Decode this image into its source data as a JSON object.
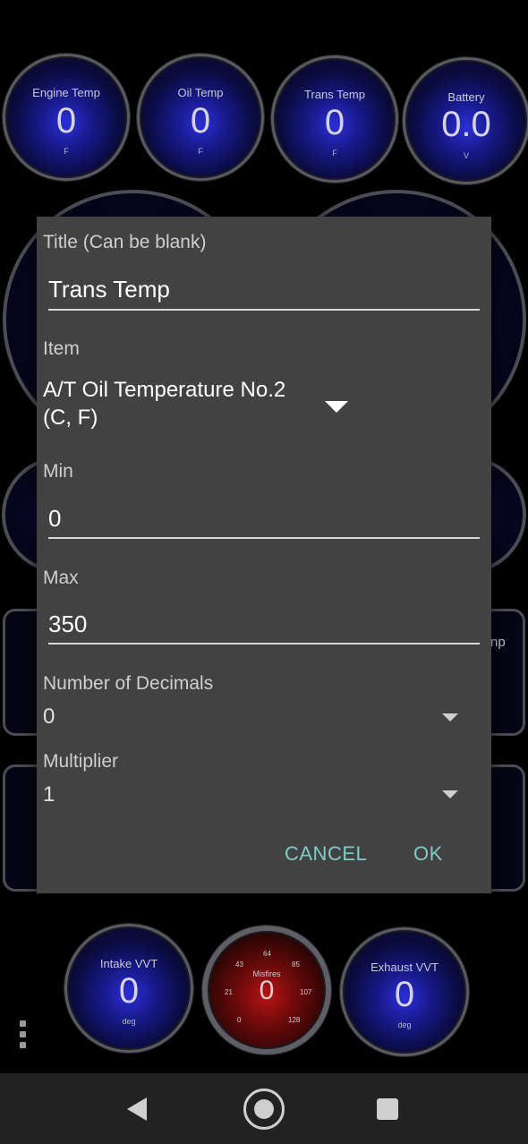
{
  "gauges_top": [
    {
      "title": "Engine Temp",
      "value": "0",
      "unit": "F"
    },
    {
      "title": "Oil Temp",
      "value": "0",
      "unit": "F"
    },
    {
      "title": "Trans Temp",
      "value": "0",
      "unit": "F"
    },
    {
      "title": "Battery",
      "value": "0.0",
      "unit": "V"
    }
  ],
  "background_partial_label": "np",
  "gauges_bottom": [
    {
      "title": "Intake VVT",
      "value": "0",
      "unit": "deg"
    },
    {
      "title": "Misfires",
      "value": "0",
      "ticks": [
        "64",
        "43",
        "85",
        "21",
        "107",
        "0",
        "128"
      ]
    },
    {
      "title": "Exhaust VVT",
      "value": "0",
      "unit": "deg"
    }
  ],
  "dialog": {
    "title_label": "Title (Can be blank)",
    "title_value": "Trans Temp",
    "item_label": "Item",
    "item_value_line1": "A/T Oil Temperature No.2",
    "item_value_line2": "(C, F)",
    "min_label": "Min",
    "min_value": "0",
    "max_label": "Max",
    "max_value": "350",
    "decimals_label": "Number of Decimals",
    "decimals_value": "0",
    "multiplier_label": "Multiplier",
    "multiplier_value": "1",
    "cancel_label": "CANCEL",
    "ok_label": "OK"
  },
  "colors": {
    "accent": "#80cbc4",
    "dialog_bg": "#424242",
    "gauge_blue": "#181a8c",
    "gauge_red": "#b51414"
  }
}
